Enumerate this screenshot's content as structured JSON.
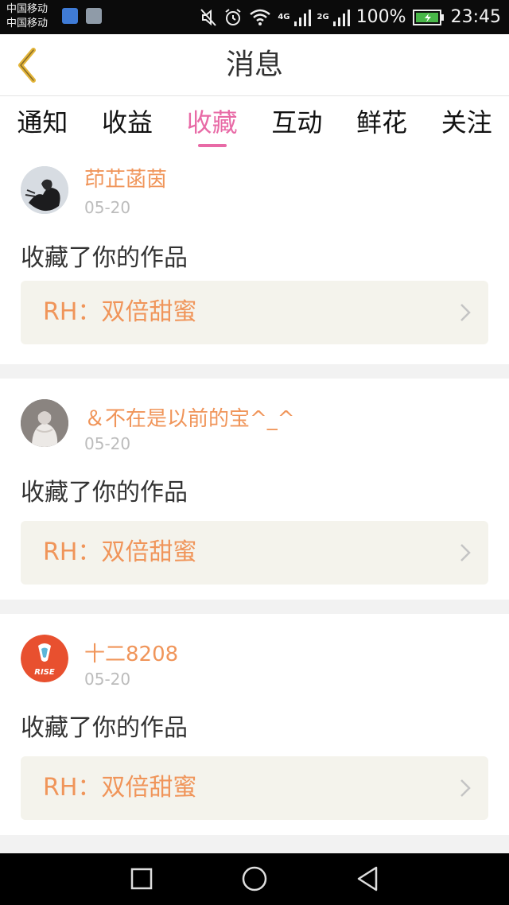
{
  "status_bar": {
    "carrier_1": "中国移动",
    "carrier_2": "中国移动",
    "net_1": "4G",
    "net_2": "2G",
    "battery_percent": "100%",
    "time": "23:45"
  },
  "header": {
    "title": "消息"
  },
  "tabs": [
    {
      "label": "通知",
      "active": false
    },
    {
      "label": "收益",
      "active": false
    },
    {
      "label": "收藏",
      "active": true
    },
    {
      "label": "互动",
      "active": false
    },
    {
      "label": "鲜花",
      "active": false
    },
    {
      "label": "关注",
      "active": false
    }
  ],
  "notifications": [
    {
      "username": "茚芷菡茵",
      "date": "05-20",
      "action": "收藏了你的作品",
      "work_title": "RH：双倍甜蜜"
    },
    {
      "username": "＆不在是以前的宝^_^",
      "date": "05-20",
      "action": "收藏了你的作品",
      "work_title": "RH：双倍甜蜜"
    },
    {
      "username": "十二8208",
      "date": "05-20",
      "action": "收藏了你的作品",
      "work_title": "RH：双倍甜蜜"
    }
  ],
  "colors": {
    "accent_pink": "#e86aa6",
    "username_orange": "#f0955a",
    "card_box_bg": "#f4f3ec"
  }
}
